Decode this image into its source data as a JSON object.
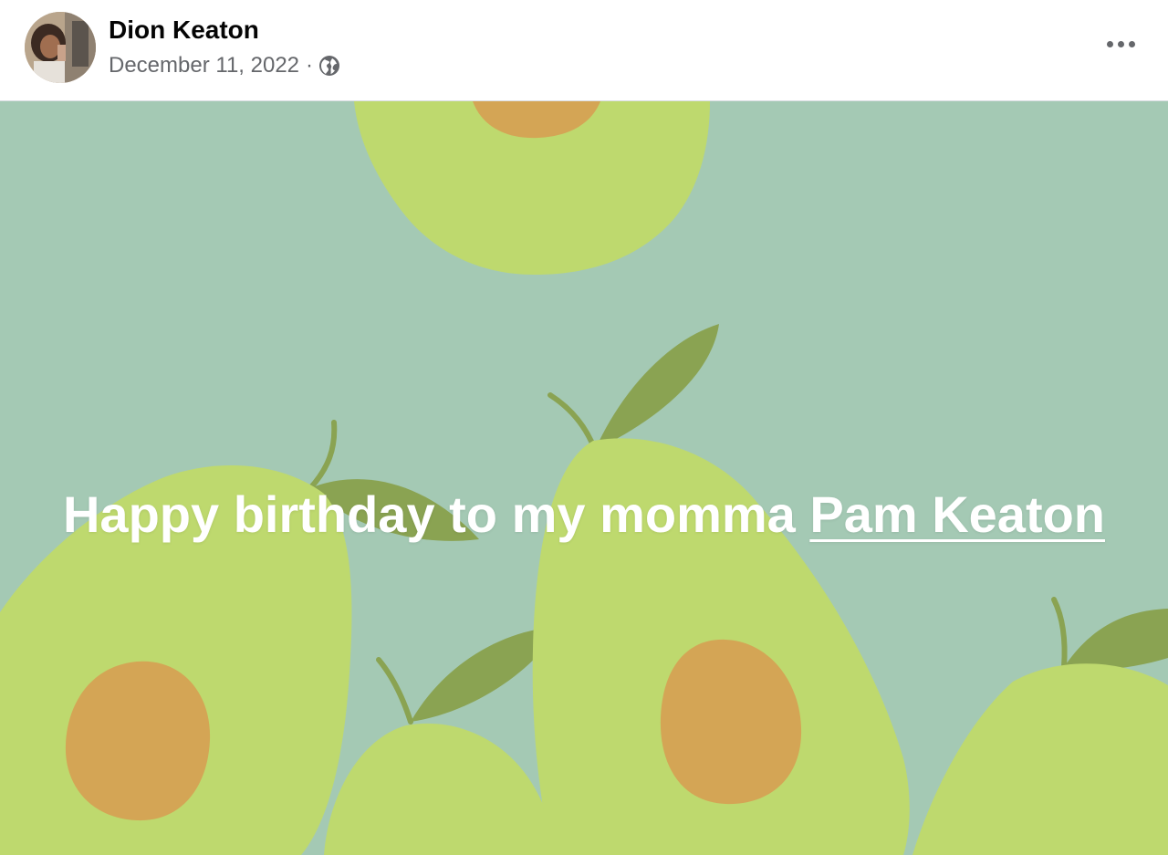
{
  "post": {
    "author": "Dion Keaton",
    "date": "December 11, 2022",
    "separator": "·",
    "audience_icon": "globe-icon",
    "menu_icon": "more-options-icon",
    "avatar_icon": "profile-photo",
    "text_prefix": "Happy birthday to my momma ",
    "mention": "Pam Keaton",
    "background": "avocado-pattern",
    "colors": {
      "background": "#a4c9b4",
      "avocado_flesh": "#bed96e",
      "avocado_pit": "#d4a555",
      "leaf": "#8aa352",
      "text": "#ffffff",
      "meta": "#65676b"
    }
  }
}
